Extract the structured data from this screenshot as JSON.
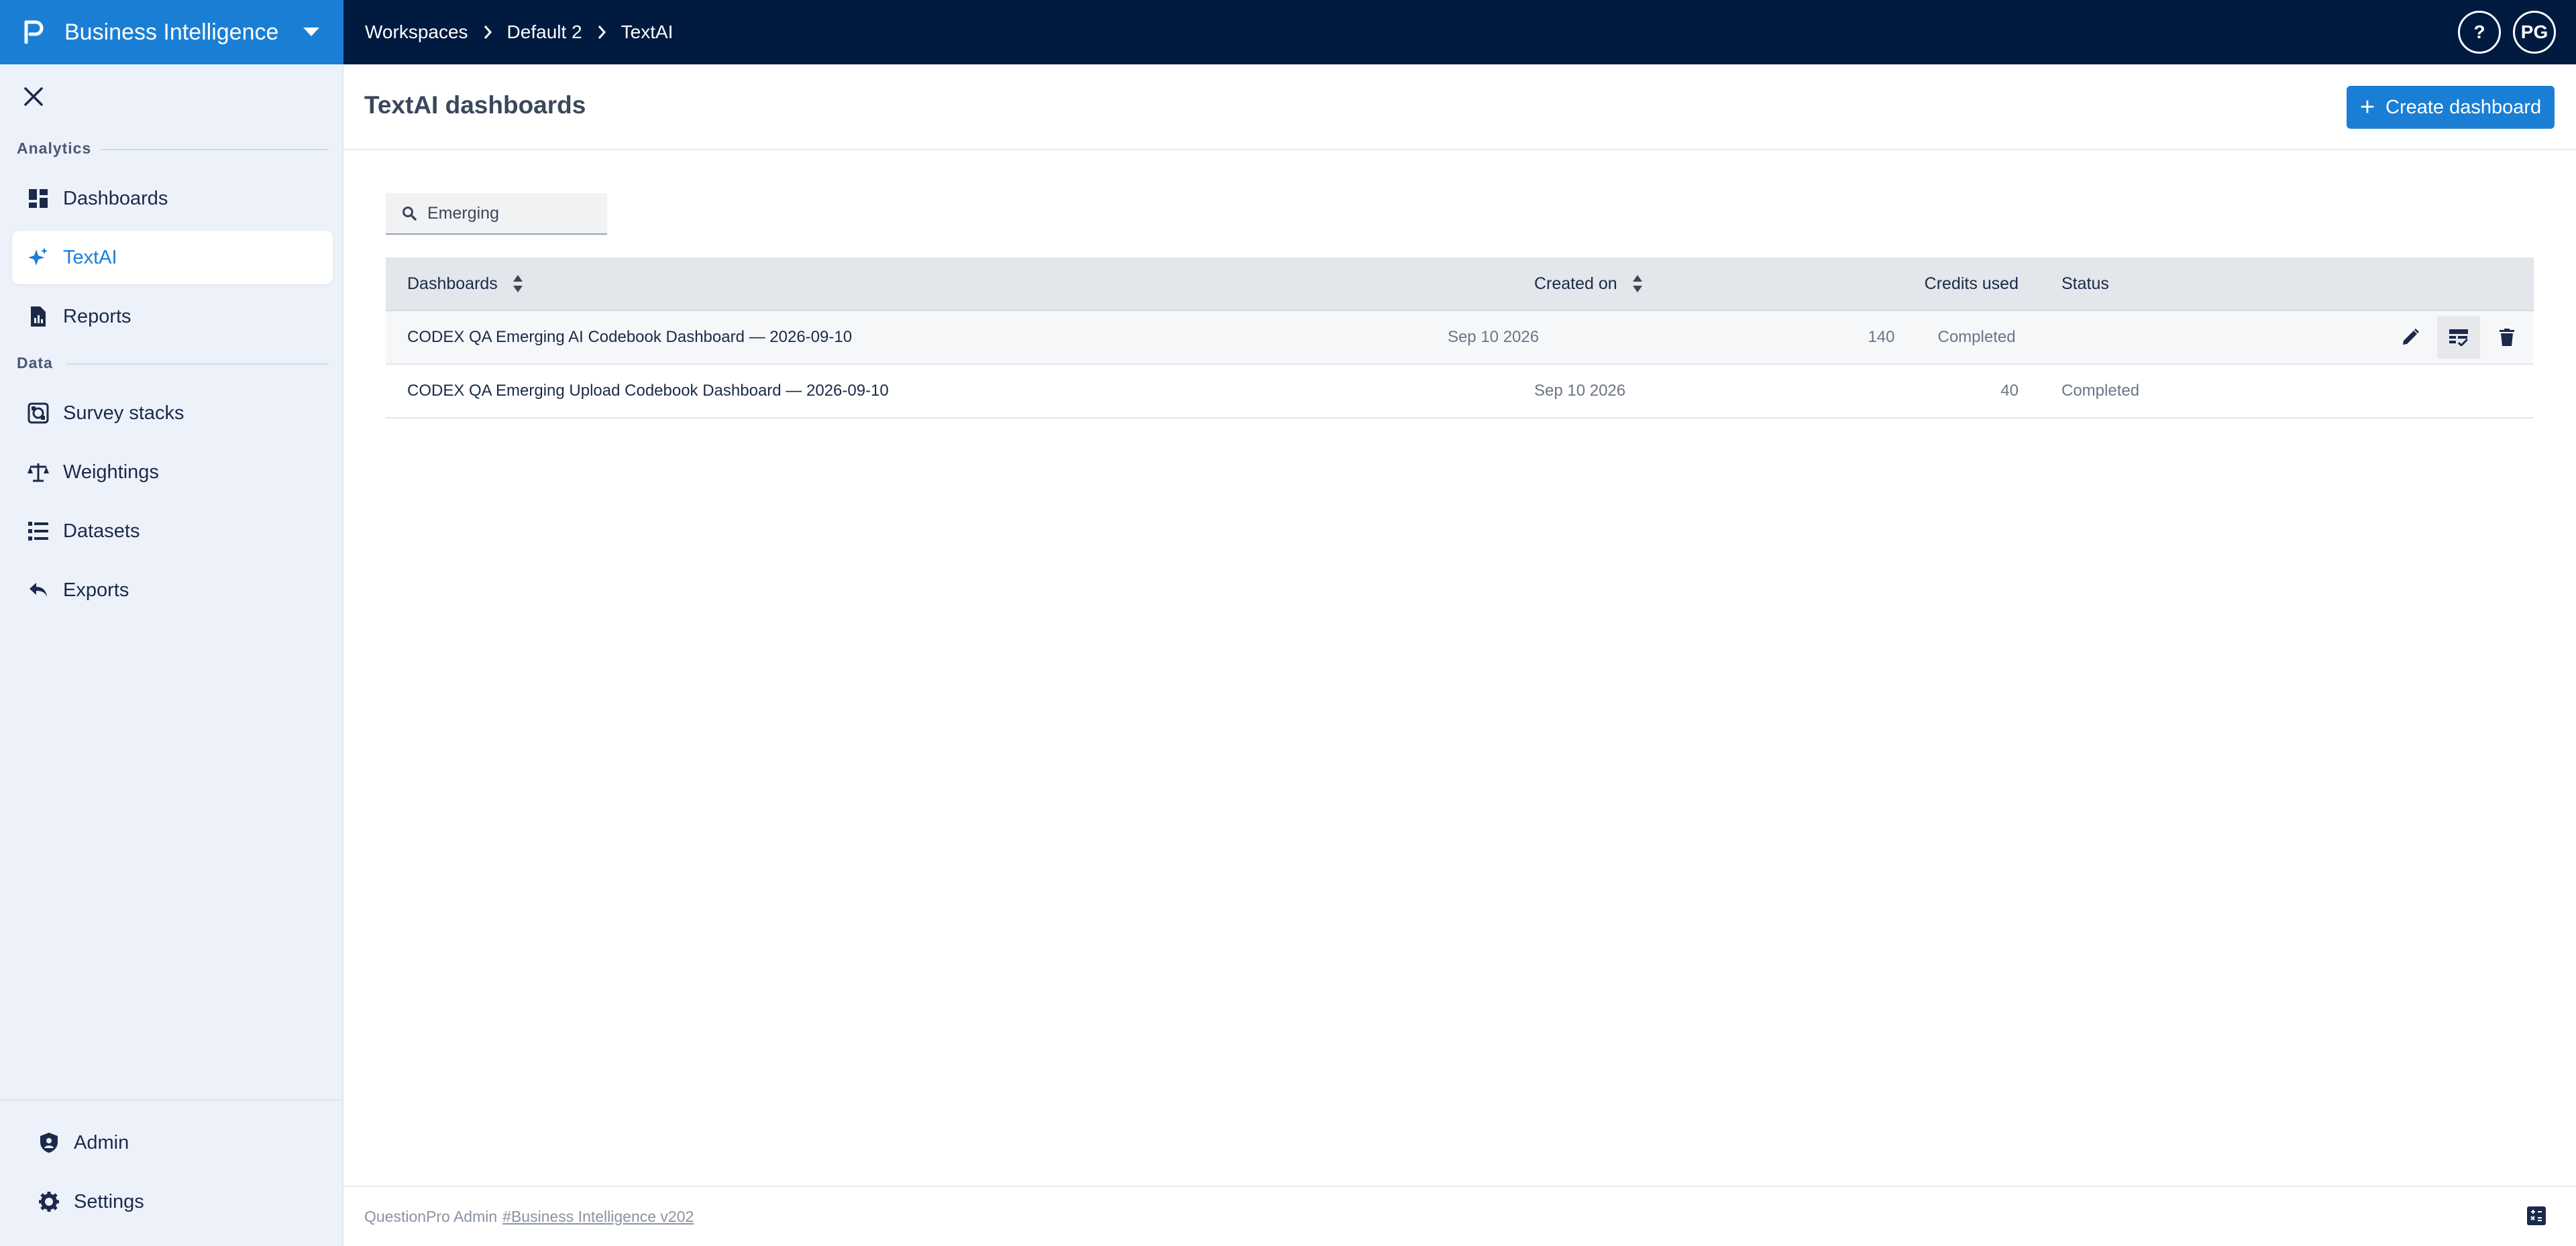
{
  "app": {
    "title": "Business Intelligence"
  },
  "breadcrumb": [
    "Workspaces",
    "Default 2",
    "TextAI"
  ],
  "user": {
    "initials": "PG",
    "help_label": "?"
  },
  "sidebar": {
    "sections": [
      {
        "label": "Analytics"
      },
      {
        "label": "Data"
      }
    ],
    "items": [
      {
        "label": "Dashboards",
        "icon": "dashboard-icon"
      },
      {
        "label": "TextAI",
        "icon": "sparkle-icon",
        "active": true
      },
      {
        "label": "Reports",
        "icon": "report-icon"
      },
      {
        "label": "Survey stacks",
        "icon": "survey-stack-icon"
      },
      {
        "label": "Weightings",
        "icon": "scale-icon"
      },
      {
        "label": "Datasets",
        "icon": "list-icon"
      },
      {
        "label": "Exports",
        "icon": "reply-icon"
      }
    ],
    "bottom_items": [
      {
        "label": "Admin",
        "icon": "admin-shield-icon"
      },
      {
        "label": "Settings",
        "icon": "gear-icon"
      }
    ]
  },
  "page": {
    "title": "TextAI dashboards",
    "create_label": "Create dashboard"
  },
  "search": {
    "value": "Emerging"
  },
  "table": {
    "columns": [
      "Dashboards",
      "Created on",
      "Credits used",
      "Status"
    ],
    "rows": [
      {
        "name": "CODEX QA Emerging AI Codebook Dashboard — 2026-09-10",
        "created": "Sep 10 2026",
        "credits": "140",
        "status": "Completed"
      },
      {
        "name": "CODEX QA Emerging Upload Codebook Dashboard — 2026-09-10",
        "created": "Sep 10 2026",
        "credits": "40",
        "status": "Completed"
      }
    ]
  },
  "footer": {
    "text": "QuestionPro Admin",
    "version": "#Business Intelligence v202"
  },
  "colors": {
    "topbar": "#001a40",
    "brand": "#1a7fd4",
    "accent": "#1a7fd4",
    "sidebar_bg": "#edf2fa"
  }
}
